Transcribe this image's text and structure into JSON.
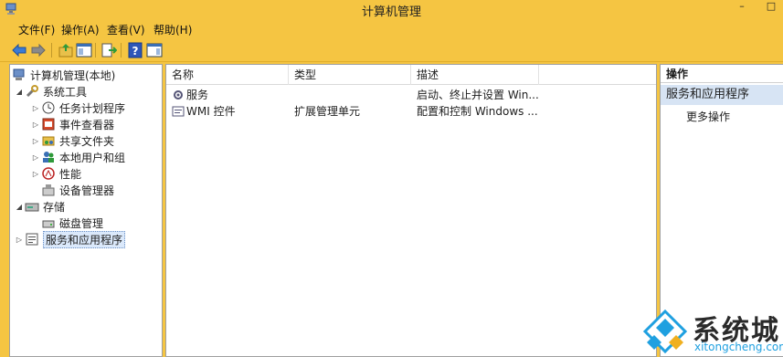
{
  "window": {
    "title": "计算机管理",
    "minimize_glyph": "–",
    "maximize_glyph": "□"
  },
  "menu": [
    {
      "label": "文件(F)"
    },
    {
      "label": "操作(A)"
    },
    {
      "label": "查看(V)"
    },
    {
      "label": "帮助(H)"
    }
  ],
  "toolbar": {
    "icons": [
      "back-arrow-icon",
      "forward-arrow-icon",
      "up-folder-icon",
      "show-hide-console-tree-icon",
      "export-list-icon",
      "help-icon",
      "show-hide-action-pane-icon"
    ]
  },
  "tree": {
    "root": "计算机管理(本地)",
    "system_tools": "系统工具",
    "task_scheduler": "任务计划程序",
    "event_viewer": "事件查看器",
    "shared_folders": "共享文件夹",
    "local_users": "本地用户和组",
    "performance": "性能",
    "device_manager": "设备管理器",
    "storage": "存储",
    "disk_management": "磁盘管理",
    "services_apps": "服务和应用程序"
  },
  "list": {
    "columns": [
      "名称",
      "类型",
      "描述"
    ],
    "rows": [
      {
        "name": "服务",
        "type": "",
        "desc": "启动、终止并设置 Win..."
      },
      {
        "name": "WMI 控件",
        "type": "扩展管理单元",
        "desc": "配置和控制 Windows ..."
      }
    ]
  },
  "actions": {
    "title": "操作",
    "section": "服务和应用程序",
    "more": "更多操作"
  },
  "watermark": {
    "cn": "系统城",
    "en": "xitongcheng.com"
  },
  "colors": {
    "frame": "#f5c542",
    "selection": "#dbe9fb",
    "action_section": "#d7e4f4",
    "watermark_blue": "#1fa0e0"
  }
}
